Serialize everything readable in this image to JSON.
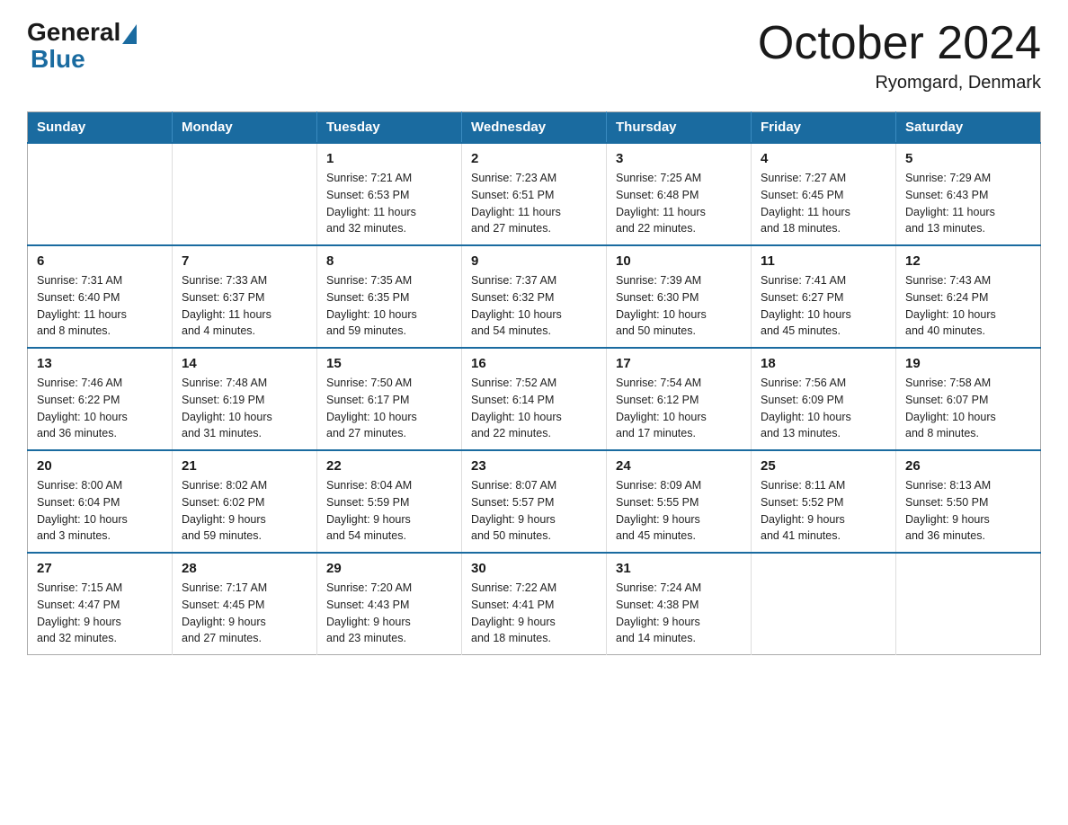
{
  "header": {
    "logo": {
      "general_text": "General",
      "blue_text": "Blue"
    },
    "title": "October 2024",
    "location": "Ryomgard, Denmark"
  },
  "calendar": {
    "days_of_week": [
      "Sunday",
      "Monday",
      "Tuesday",
      "Wednesday",
      "Thursday",
      "Friday",
      "Saturday"
    ],
    "weeks": [
      [
        {
          "day": "",
          "info": ""
        },
        {
          "day": "",
          "info": ""
        },
        {
          "day": "1",
          "info": "Sunrise: 7:21 AM\nSunset: 6:53 PM\nDaylight: 11 hours\nand 32 minutes."
        },
        {
          "day": "2",
          "info": "Sunrise: 7:23 AM\nSunset: 6:51 PM\nDaylight: 11 hours\nand 27 minutes."
        },
        {
          "day": "3",
          "info": "Sunrise: 7:25 AM\nSunset: 6:48 PM\nDaylight: 11 hours\nand 22 minutes."
        },
        {
          "day": "4",
          "info": "Sunrise: 7:27 AM\nSunset: 6:45 PM\nDaylight: 11 hours\nand 18 minutes."
        },
        {
          "day": "5",
          "info": "Sunrise: 7:29 AM\nSunset: 6:43 PM\nDaylight: 11 hours\nand 13 minutes."
        }
      ],
      [
        {
          "day": "6",
          "info": "Sunrise: 7:31 AM\nSunset: 6:40 PM\nDaylight: 11 hours\nand 8 minutes."
        },
        {
          "day": "7",
          "info": "Sunrise: 7:33 AM\nSunset: 6:37 PM\nDaylight: 11 hours\nand 4 minutes."
        },
        {
          "day": "8",
          "info": "Sunrise: 7:35 AM\nSunset: 6:35 PM\nDaylight: 10 hours\nand 59 minutes."
        },
        {
          "day": "9",
          "info": "Sunrise: 7:37 AM\nSunset: 6:32 PM\nDaylight: 10 hours\nand 54 minutes."
        },
        {
          "day": "10",
          "info": "Sunrise: 7:39 AM\nSunset: 6:30 PM\nDaylight: 10 hours\nand 50 minutes."
        },
        {
          "day": "11",
          "info": "Sunrise: 7:41 AM\nSunset: 6:27 PM\nDaylight: 10 hours\nand 45 minutes."
        },
        {
          "day": "12",
          "info": "Sunrise: 7:43 AM\nSunset: 6:24 PM\nDaylight: 10 hours\nand 40 minutes."
        }
      ],
      [
        {
          "day": "13",
          "info": "Sunrise: 7:46 AM\nSunset: 6:22 PM\nDaylight: 10 hours\nand 36 minutes."
        },
        {
          "day": "14",
          "info": "Sunrise: 7:48 AM\nSunset: 6:19 PM\nDaylight: 10 hours\nand 31 minutes."
        },
        {
          "day": "15",
          "info": "Sunrise: 7:50 AM\nSunset: 6:17 PM\nDaylight: 10 hours\nand 27 minutes."
        },
        {
          "day": "16",
          "info": "Sunrise: 7:52 AM\nSunset: 6:14 PM\nDaylight: 10 hours\nand 22 minutes."
        },
        {
          "day": "17",
          "info": "Sunrise: 7:54 AM\nSunset: 6:12 PM\nDaylight: 10 hours\nand 17 minutes."
        },
        {
          "day": "18",
          "info": "Sunrise: 7:56 AM\nSunset: 6:09 PM\nDaylight: 10 hours\nand 13 minutes."
        },
        {
          "day": "19",
          "info": "Sunrise: 7:58 AM\nSunset: 6:07 PM\nDaylight: 10 hours\nand 8 minutes."
        }
      ],
      [
        {
          "day": "20",
          "info": "Sunrise: 8:00 AM\nSunset: 6:04 PM\nDaylight: 10 hours\nand 3 minutes."
        },
        {
          "day": "21",
          "info": "Sunrise: 8:02 AM\nSunset: 6:02 PM\nDaylight: 9 hours\nand 59 minutes."
        },
        {
          "day": "22",
          "info": "Sunrise: 8:04 AM\nSunset: 5:59 PM\nDaylight: 9 hours\nand 54 minutes."
        },
        {
          "day": "23",
          "info": "Sunrise: 8:07 AM\nSunset: 5:57 PM\nDaylight: 9 hours\nand 50 minutes."
        },
        {
          "day": "24",
          "info": "Sunrise: 8:09 AM\nSunset: 5:55 PM\nDaylight: 9 hours\nand 45 minutes."
        },
        {
          "day": "25",
          "info": "Sunrise: 8:11 AM\nSunset: 5:52 PM\nDaylight: 9 hours\nand 41 minutes."
        },
        {
          "day": "26",
          "info": "Sunrise: 8:13 AM\nSunset: 5:50 PM\nDaylight: 9 hours\nand 36 minutes."
        }
      ],
      [
        {
          "day": "27",
          "info": "Sunrise: 7:15 AM\nSunset: 4:47 PM\nDaylight: 9 hours\nand 32 minutes."
        },
        {
          "day": "28",
          "info": "Sunrise: 7:17 AM\nSunset: 4:45 PM\nDaylight: 9 hours\nand 27 minutes."
        },
        {
          "day": "29",
          "info": "Sunrise: 7:20 AM\nSunset: 4:43 PM\nDaylight: 9 hours\nand 23 minutes."
        },
        {
          "day": "30",
          "info": "Sunrise: 7:22 AM\nSunset: 4:41 PM\nDaylight: 9 hours\nand 18 minutes."
        },
        {
          "day": "31",
          "info": "Sunrise: 7:24 AM\nSunset: 4:38 PM\nDaylight: 9 hours\nand 14 minutes."
        },
        {
          "day": "",
          "info": ""
        },
        {
          "day": "",
          "info": ""
        }
      ]
    ]
  }
}
